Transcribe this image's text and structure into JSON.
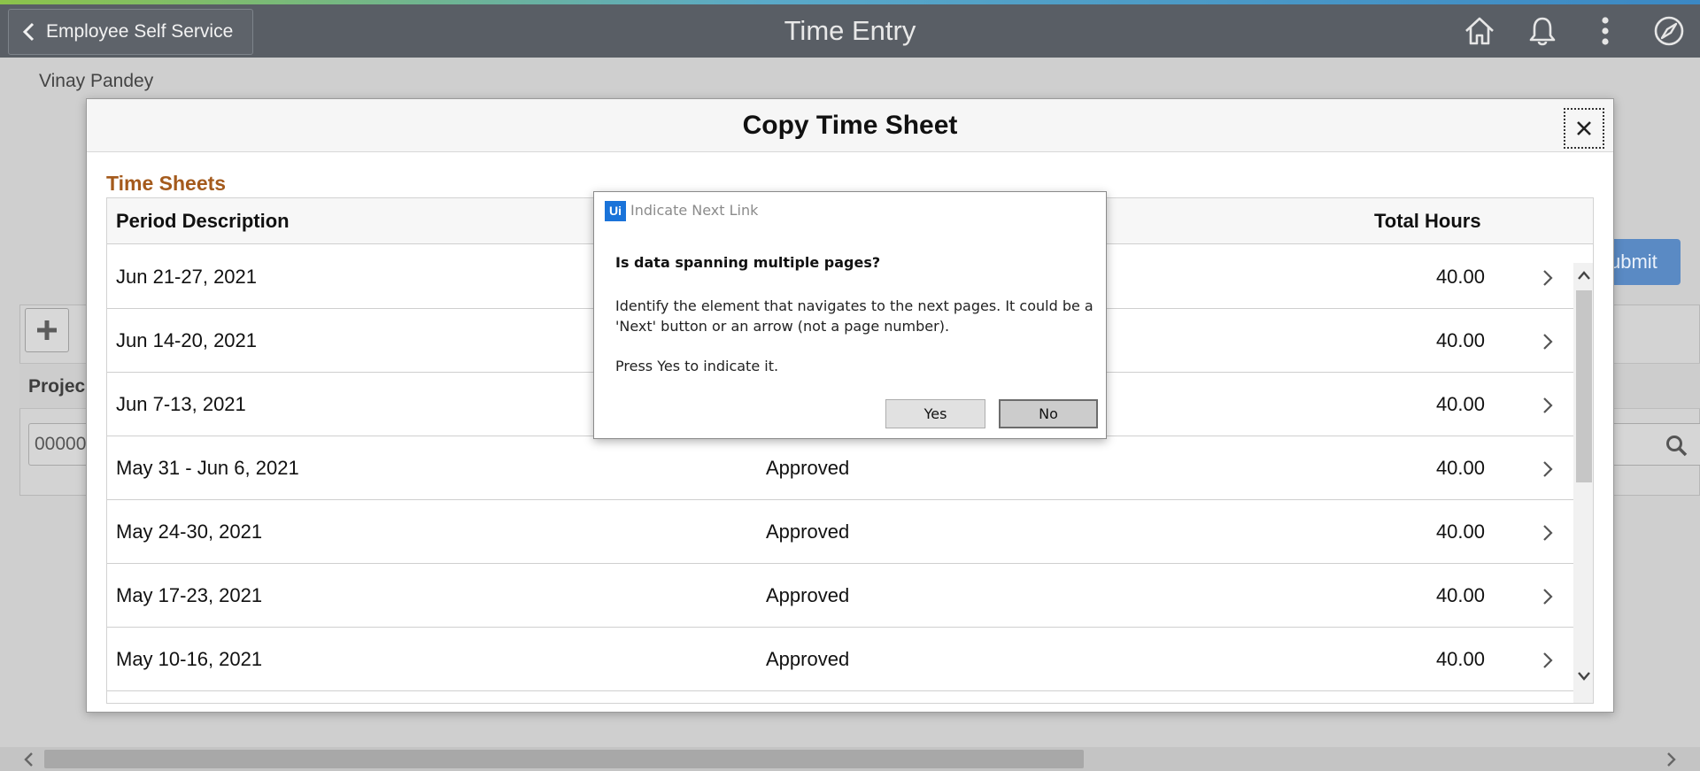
{
  "header": {
    "back_label": "Employee Self Service",
    "title": "Time Entry",
    "icons": [
      "home-icon",
      "bell-icon",
      "more-vertical-icon",
      "compass-icon"
    ]
  },
  "user_name": "Vinay Pandey",
  "background": {
    "submit_label": "ubmit",
    "project_label": "Projec",
    "project_value": "00000"
  },
  "modal": {
    "title": "Copy Time Sheet",
    "section_title": "Time Sheets",
    "columns": [
      "Period Description",
      "",
      "Total Hours"
    ],
    "rows": [
      {
        "period": "Jun 21-27, 2021",
        "status": "",
        "hours": "40.00"
      },
      {
        "period": "Jun 14-20, 2021",
        "status": "",
        "hours": "40.00"
      },
      {
        "period": "Jun 7-13, 2021",
        "status": "",
        "hours": "40.00"
      },
      {
        "period": "May 31 - Jun 6, 2021",
        "status": "Approved",
        "hours": "40.00"
      },
      {
        "period": "May 24-30, 2021",
        "status": "Approved",
        "hours": "40.00"
      },
      {
        "period": "May 17-23, 2021",
        "status": "Approved",
        "hours": "40.00"
      },
      {
        "period": "May 10-16, 2021",
        "status": "Approved",
        "hours": "40.00"
      }
    ]
  },
  "dialog": {
    "logo": "Ui",
    "title": "Indicate Next Link",
    "question": "Is data spanning multiple pages?",
    "description": "Identify the element that navigates to the next pages. It could be a 'Next' button or an arrow (not a page number).",
    "hint": "Press Yes to indicate it.",
    "yes_label": "Yes",
    "no_label": "No"
  },
  "colors": {
    "banner": "#595e65",
    "section_title": "#a45a1c",
    "submit": "#5a8ac4",
    "ui_logo": "#1a73d9"
  }
}
